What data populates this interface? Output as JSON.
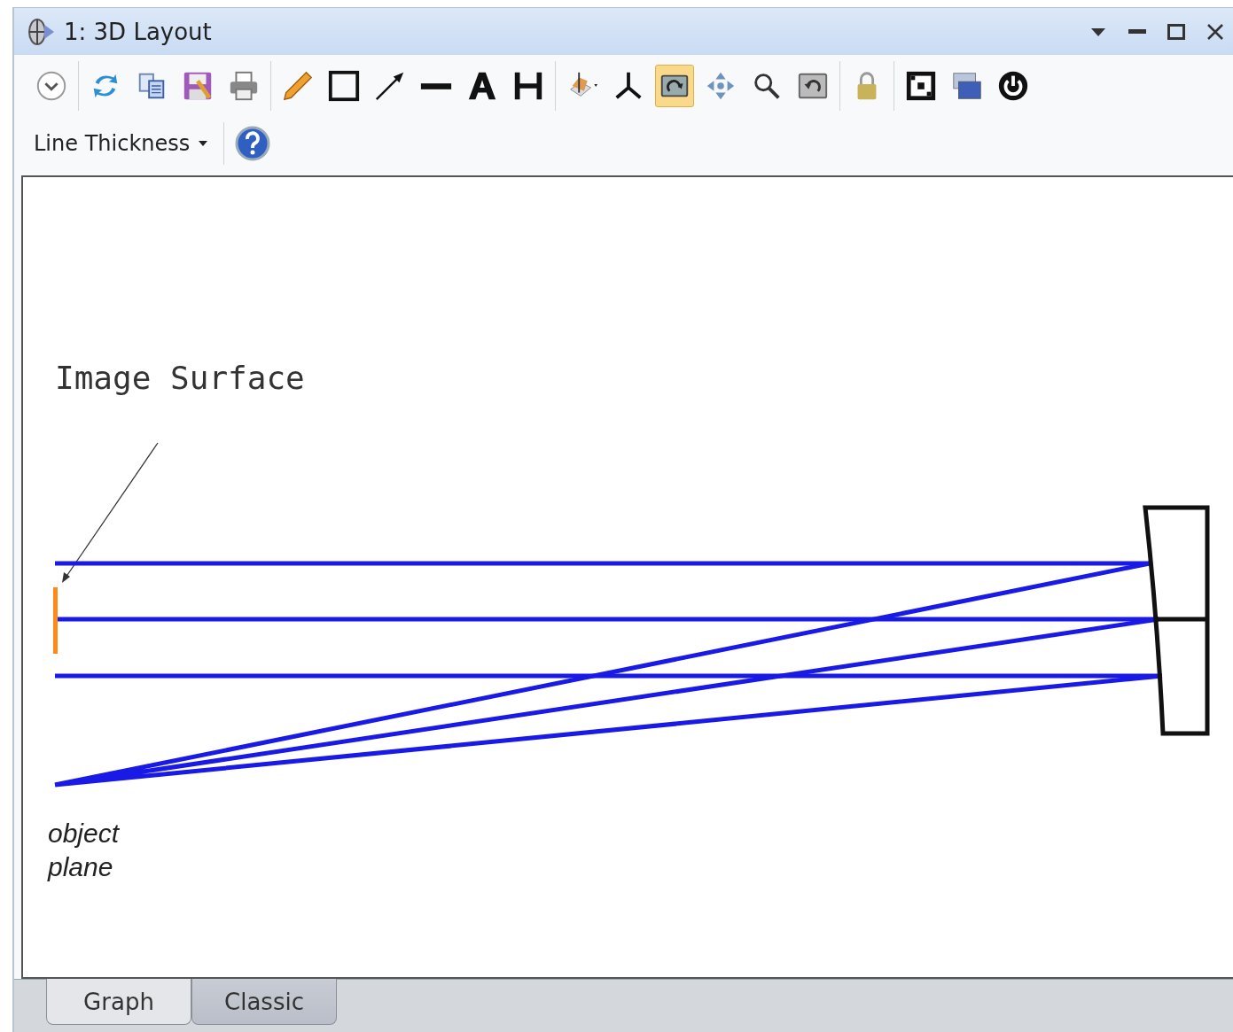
{
  "window": {
    "title": "1: 3D Layout"
  },
  "toolbar": {
    "groups": [
      {
        "items": [
          {
            "kind": "expand",
            "selected": false
          }
        ]
      },
      {
        "items": [
          {
            "kind": "refresh",
            "selected": false
          },
          {
            "kind": "copy",
            "selected": false
          },
          {
            "kind": "save",
            "selected": false
          },
          {
            "kind": "print",
            "selected": false
          }
        ]
      },
      {
        "items": [
          {
            "kind": "pencil",
            "selected": false
          },
          {
            "kind": "rectangle",
            "selected": false
          },
          {
            "kind": "arrow",
            "selected": false
          },
          {
            "kind": "line",
            "selected": false
          },
          {
            "kind": "text",
            "selected": false
          },
          {
            "kind": "dimension",
            "selected": false
          }
        ]
      },
      {
        "items": [
          {
            "kind": "view3d",
            "selected": false
          },
          {
            "kind": "axes",
            "selected": false
          },
          {
            "kind": "rotate",
            "selected": true
          },
          {
            "kind": "pan",
            "selected": false
          },
          {
            "kind": "zoom",
            "selected": false
          },
          {
            "kind": "reset",
            "selected": false
          }
        ]
      },
      {
        "items": [
          {
            "kind": "lock",
            "selected": false
          }
        ]
      },
      {
        "items": [
          {
            "kind": "fit",
            "selected": false
          },
          {
            "kind": "windows",
            "selected": false
          },
          {
            "kind": "power",
            "selected": false
          }
        ]
      }
    ],
    "line_thickness": {
      "label": "Line Thickness"
    }
  },
  "diagram": {
    "labels": [
      {
        "kind": "surface",
        "text": "Image Surface"
      },
      {
        "kind": "object",
        "text": "object plane"
      }
    ]
  },
  "tabs": [
    {
      "label": "Graph",
      "selected": true
    },
    {
      "label": "Classic",
      "selected": false
    }
  ]
}
